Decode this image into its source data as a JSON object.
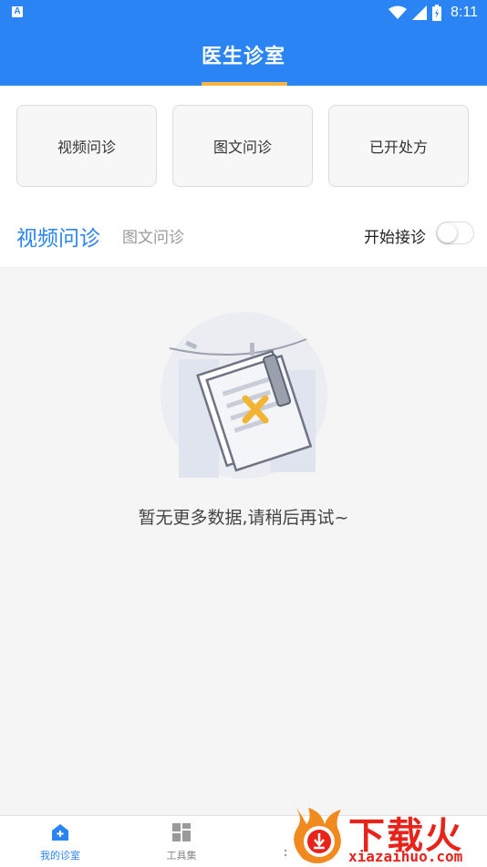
{
  "status_bar": {
    "app_badge": "A",
    "time": "8:11"
  },
  "header": {
    "title": "医生诊室",
    "underline_color": "#f6b443",
    "background": "#2a84f4"
  },
  "cards": [
    {
      "label": "视频问诊"
    },
    {
      "label": "图文问诊"
    },
    {
      "label": "已开处方"
    }
  ],
  "tabs": {
    "active": "视频问诊",
    "inactive": "图文问诊"
  },
  "accept_toggle": {
    "label": "开始接诊",
    "on": false
  },
  "empty_state": {
    "icon": "empty-document-icon",
    "message": "暂无更多数据,请稍后再试~"
  },
  "bottom_nav": {
    "items": [
      {
        "label": "我的诊室",
        "icon": "home-plus-icon",
        "active": true
      },
      {
        "label": "工具集",
        "icon": "grid-icon",
        "active": false
      }
    ]
  },
  "watermark": {
    "text": "下载火",
    "url": "xiazaihuo.com"
  }
}
